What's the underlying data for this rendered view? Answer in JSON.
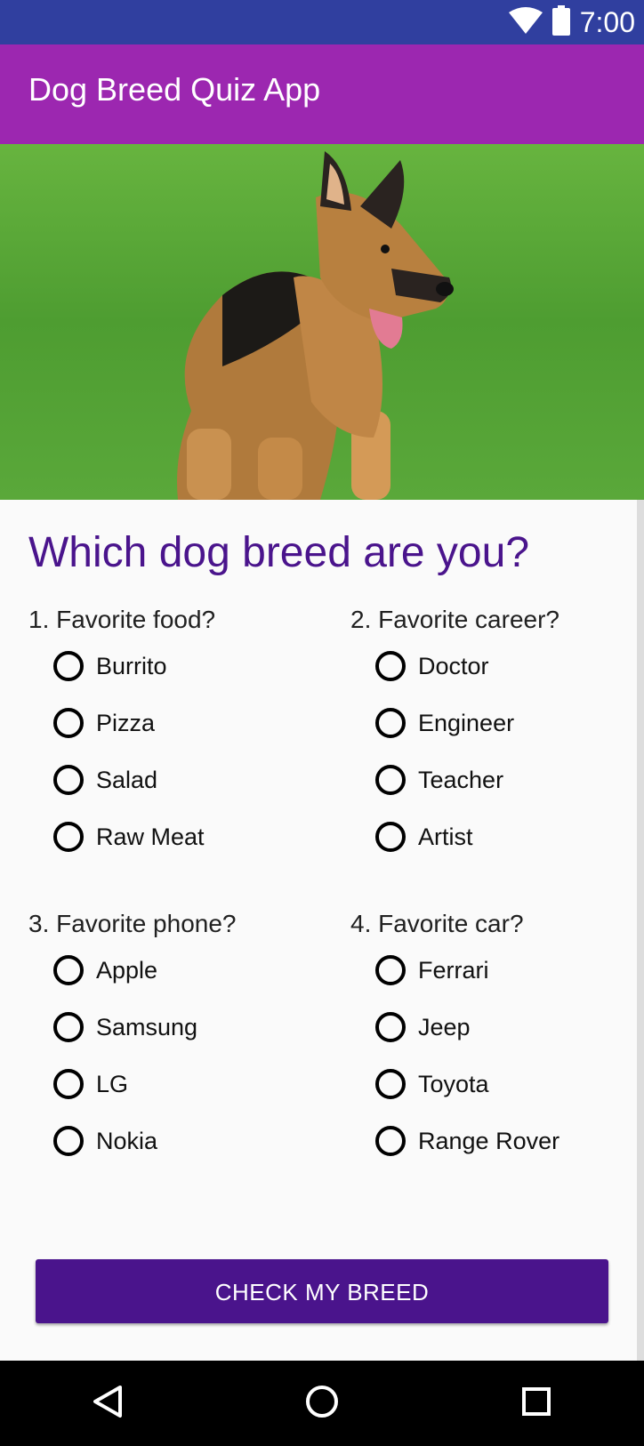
{
  "status_bar": {
    "time": "7:00",
    "wifi_icon": "wifi-icon",
    "battery_icon": "battery-icon"
  },
  "app_bar": {
    "title": "Dog Breed Quiz App"
  },
  "hero_image": {
    "subject": "german-shepherd-dog-on-grass"
  },
  "headline": "Which dog breed are you?",
  "questions": [
    {
      "title": "1. Favorite food?",
      "options": [
        "Burrito",
        "Pizza",
        "Salad",
        "Raw Meat"
      ]
    },
    {
      "title": "2. Favorite career?",
      "options": [
        "Doctor",
        "Engineer",
        "Teacher",
        "Artist"
      ]
    },
    {
      "title": "3. Favorite phone?",
      "options": [
        "Apple",
        "Samsung",
        "LG",
        "Nokia"
      ]
    },
    {
      "title": "4. Favorite car?",
      "options": [
        "Ferrari",
        "Jeep",
        "Toyota",
        "Range Rover"
      ]
    }
  ],
  "check_button": {
    "label": "CHECK MY BREED"
  },
  "nav_bar": {
    "back_icon": "back-icon",
    "home_icon": "home-icon",
    "recents_icon": "recents-icon"
  },
  "colors": {
    "status_bar": "#303f9f",
    "app_bar": "#9c27b0",
    "accent": "#4a148c",
    "nav_bar": "#000000"
  }
}
